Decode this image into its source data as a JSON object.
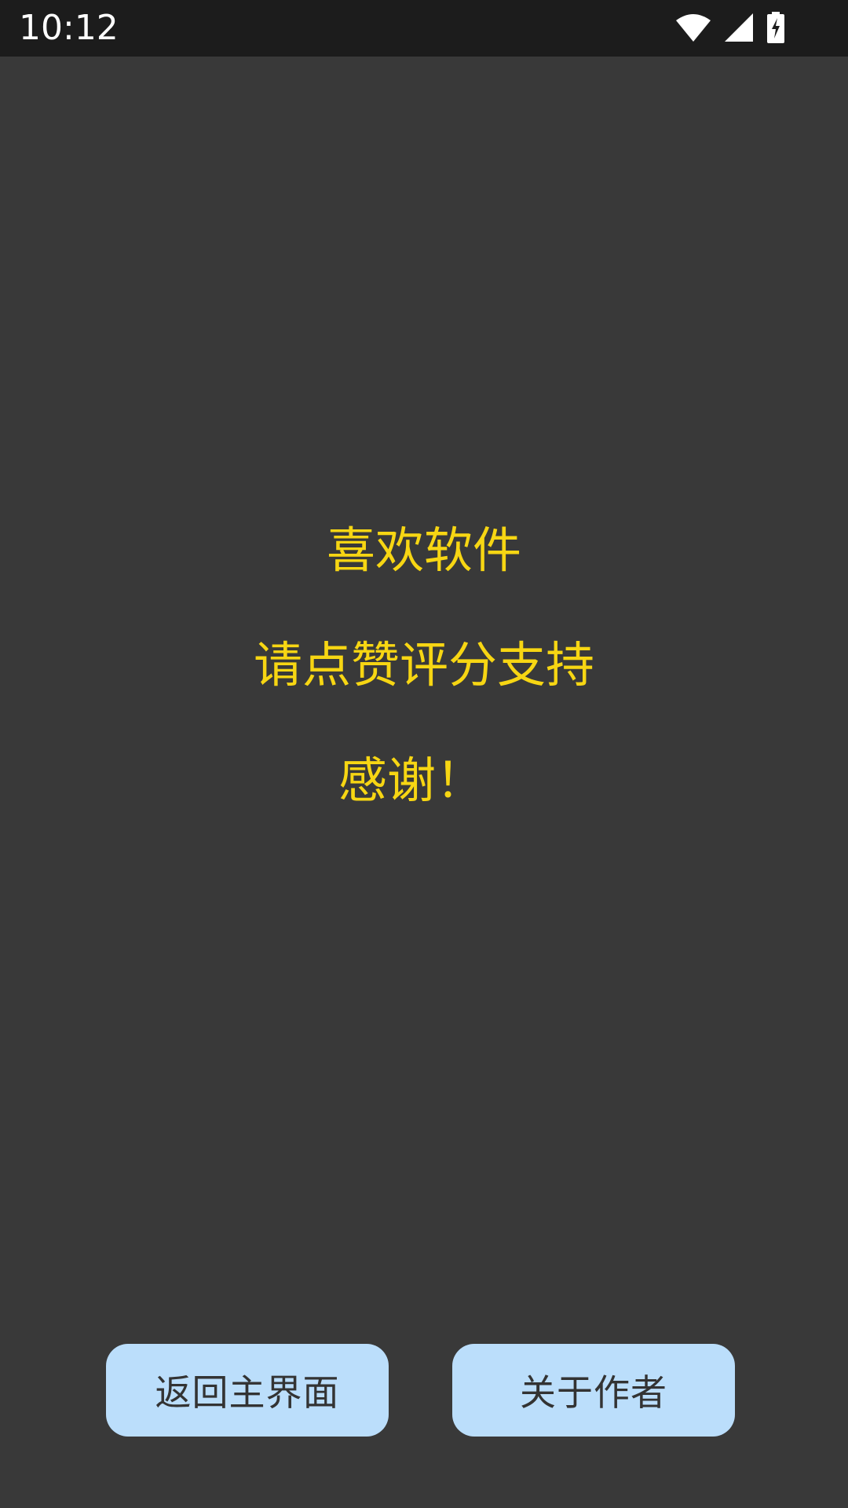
{
  "status_bar": {
    "time": "10:12",
    "icons": [
      "wifi-icon",
      "cellular-signal-icon",
      "battery-charging-icon"
    ]
  },
  "message": {
    "line1": "喜欢软件",
    "line2": "请点赞评分支持",
    "line3": "感谢！"
  },
  "buttons": {
    "back_label": "返回主界面",
    "about_label": "关于作者"
  },
  "colors": {
    "background": "#393939",
    "status_bar": "#1c1c1c",
    "message_text": "#f7d613",
    "button_bg": "#bbdefb",
    "button_text": "#333333"
  }
}
